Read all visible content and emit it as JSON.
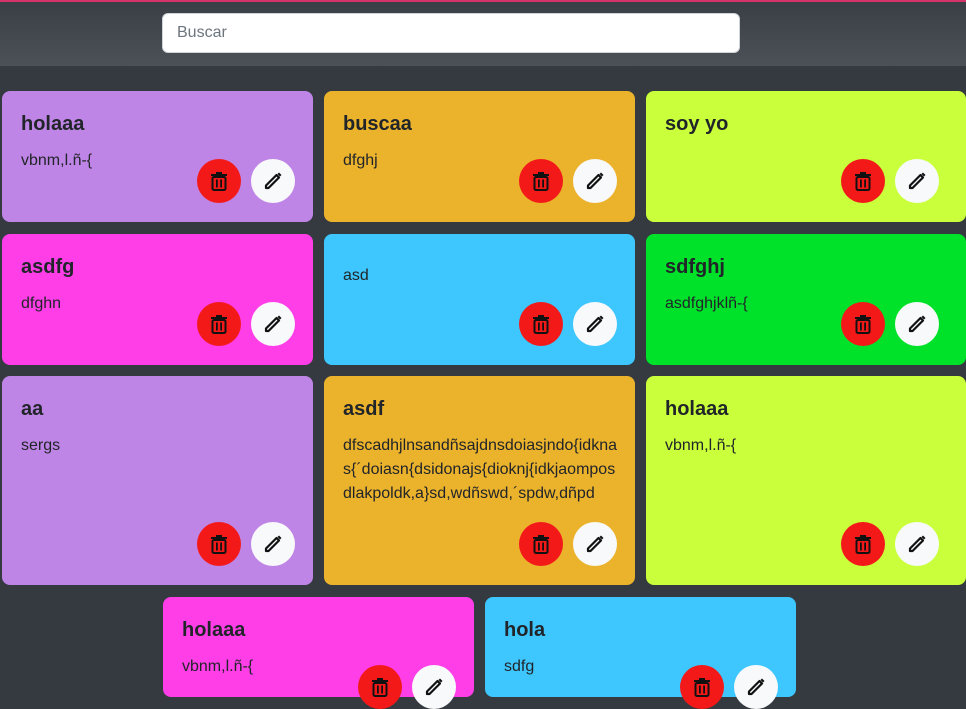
{
  "search": {
    "placeholder": "Buscar",
    "value": ""
  },
  "notes": [
    {
      "title": "holaaa",
      "text": "vbnm,l.ñ-{",
      "color": "#bf85e6"
    },
    {
      "title": "buscaa",
      "text": "dfghj",
      "color": "#ebb22c"
    },
    {
      "title": "soy yo",
      "text": "",
      "color": "#c9ff3b"
    },
    {
      "title": "asdfg",
      "text": "dfghn",
      "color": "#ff3ee8"
    },
    {
      "title": "",
      "text": "asd",
      "color": "#3ec6ff"
    },
    {
      "title": "sdfghj",
      "text": "asdfghjklñ-{",
      "color": "#00e22a"
    },
    {
      "title": "aa",
      "text": "sergs",
      "color": "#bf85e6"
    },
    {
      "title": "asdf",
      "text": "dfscadhjlnsandñsajdnsdoiasjndo{idknas{´doiasn{dsidonajs{dioknj{idkjaomposdlakpoldk,a}sd,wdñswd,´spdw,dñpd",
      "color": "#ebb22c"
    },
    {
      "title": "holaaa",
      "text": "vbnm,l.ñ-{",
      "color": "#c9ff3b"
    },
    {
      "title": "holaaa",
      "text": "vbnm,l.ñ-{",
      "color": "#ff3ee8"
    },
    {
      "title": "hola",
      "text": "sdfg",
      "color": "#3ec6ff"
    }
  ],
  "icons": {
    "delete": "trash-icon",
    "edit": "pencil-icon"
  },
  "colors": {
    "delete_button": "#f41919",
    "edit_button": "#f8f9fa",
    "background": "#343a40"
  }
}
